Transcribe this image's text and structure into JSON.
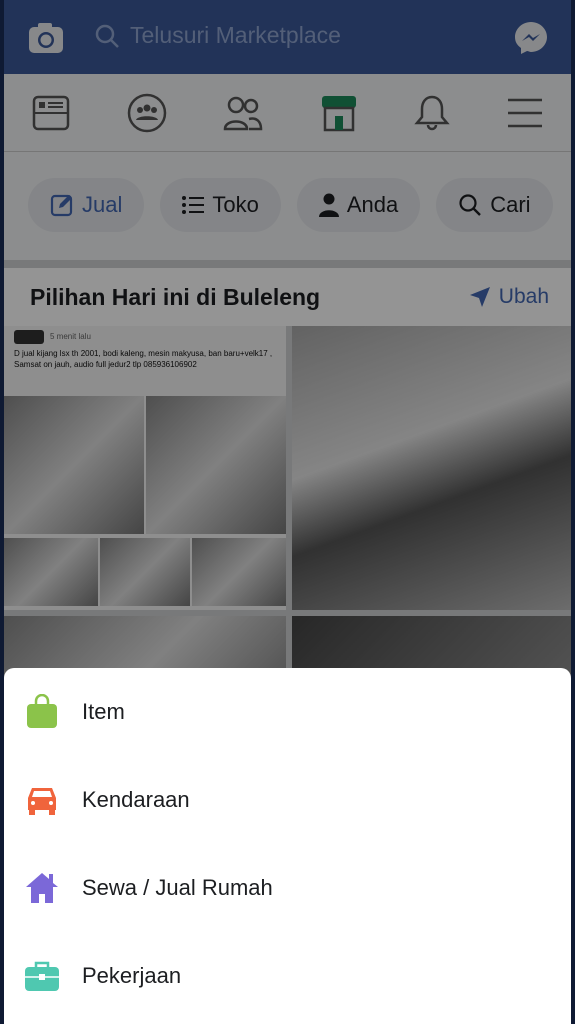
{
  "search": {
    "placeholder": "Telusuri Marketplace"
  },
  "nav": {
    "icons": [
      "news-feed-icon",
      "groups-icon",
      "friends-icon",
      "marketplace-icon",
      "notifications-icon",
      "menu-icon"
    ],
    "active": "marketplace-icon",
    "active_color": "#1d8a5a"
  },
  "chips": [
    {
      "label": "Jual",
      "icon": "edit-icon"
    },
    {
      "label": "Toko",
      "icon": "list-icon"
    },
    {
      "label": "Anda",
      "icon": "person-icon"
    },
    {
      "label": "Cari",
      "icon": "search-icon"
    }
  ],
  "section": {
    "title": "Pilihan Hari ini di Buleleng",
    "action": "Ubah"
  },
  "listing": {
    "time": "5 menit lalu",
    "text": "D jual kijang lsx th 2001, bodi kaleng, mesin makyusa, ban baru+velk17 , Samsat on jauh, audio full jedur2 tlp 085936106902"
  },
  "sheet": {
    "items": [
      {
        "label": "Item",
        "icon": "shopping-bag-icon",
        "color": "#8bc34a"
      },
      {
        "label": "Kendaraan",
        "icon": "car-icon",
        "color": "#f0643c"
      },
      {
        "label": "Sewa / Jual Rumah",
        "icon": "house-icon",
        "color": "#7b68d8"
      },
      {
        "label": "Pekerjaan",
        "icon": "briefcase-icon",
        "color": "#4fc8b0"
      }
    ]
  }
}
